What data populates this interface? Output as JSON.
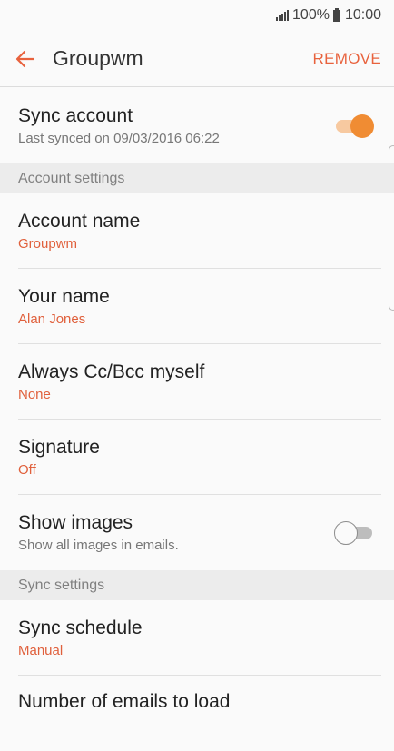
{
  "status_bar": {
    "battery": "100%",
    "time": "10:00"
  },
  "header": {
    "title": "Groupwm",
    "remove_label": "REMOVE"
  },
  "sync_account": {
    "title": "Sync account",
    "subtitle": "Last synced on 09/03/2016 06:22",
    "enabled": true
  },
  "sections": {
    "account_settings": "Account settings",
    "sync_settings": "Sync settings"
  },
  "account_name": {
    "title": "Account name",
    "value": "Groupwm"
  },
  "your_name": {
    "title": "Your name",
    "value": "Alan Jones"
  },
  "always_cc": {
    "title": "Always Cc/Bcc myself",
    "value": "None"
  },
  "signature": {
    "title": "Signature",
    "value": "Off"
  },
  "show_images": {
    "title": "Show images",
    "subtitle": "Show all images in emails.",
    "enabled": false
  },
  "sync_schedule": {
    "title": "Sync schedule",
    "value": "Manual"
  },
  "emails_to_load": {
    "title": "Number of emails to load"
  },
  "colors": {
    "accent": "#e8623d",
    "toggle_on": "#f08c33",
    "section_bg": "#ececec"
  }
}
